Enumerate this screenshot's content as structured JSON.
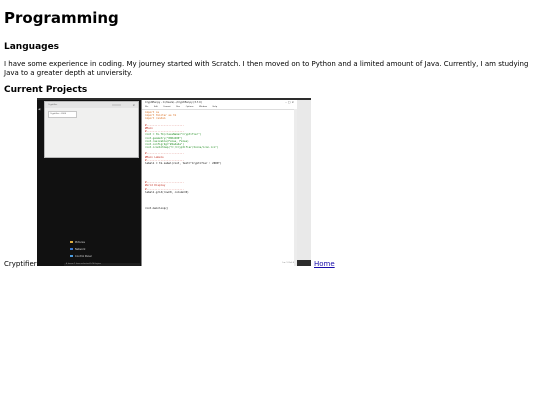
{
  "page": {
    "title": "Programming",
    "languages_heading": "Languages",
    "languages_text": "I have some experience in coding. My journey started with Scratch. I then moved on to Python and a limited amount of Java. Currently, I am studying Java to a greater depth at unviersity.",
    "projects_heading": "Current Projects",
    "project_label": "Cryptifier",
    "home_link": "Home"
  },
  "screenshot": {
    "dialog_title": "Cryptifier",
    "dialog_field": "Cryptifier.: 2000",
    "ide_title": "Cryptifier.py - C:/Users/.../Cryptifier.py (3.7.0)",
    "ide_menu": [
      "File",
      "Edit",
      "Format",
      "Run",
      "Options",
      "Window",
      "Help"
    ],
    "explorer_items": [
      "Pictures",
      "Network",
      "Control Panel"
    ],
    "status_text": "4 items   1 item selected  5.96 bytes",
    "code_lines": [
      {
        "t": "import os",
        "c": "kw"
      },
      {
        "t": "import tkinter as tk",
        "c": "kw"
      },
      {
        "t": "import random",
        "c": "kw"
      },
      {
        "t": "",
        "c": "df"
      },
      {
        "t": "#------------------------",
        "c": "cm"
      },
      {
        "t": "#Main",
        "c": "cm"
      },
      {
        "t": "#------------------------",
        "c": "cm"
      },
      {
        "t": "root = tk.Tk(className=\"Cryptifier\")",
        "c": "st"
      },
      {
        "t": "root.geometry(\"800x600\")",
        "c": "st"
      },
      {
        "t": "root.resizable(False, False)",
        "c": "st"
      },
      {
        "t": "root.config(bg=\"#4a4a4a\")",
        "c": "st"
      },
      {
        "t": "root.iconbitmap(\"C:/Cryptifier/Icons/icon.ico\")",
        "c": "st"
      },
      {
        "t": "",
        "c": "df"
      },
      {
        "t": "#------------------------",
        "c": "cm"
      },
      {
        "t": "#Main Labels",
        "c": "cm"
      },
      {
        "t": "#------------------------",
        "c": "cm"
      },
      {
        "t": "label1 = tk.Label(root, text=\"Cryptifier : 2000\")",
        "c": "df"
      },
      {
        "t": "",
        "c": "df"
      },
      {
        "t": "",
        "c": "df"
      },
      {
        "t": "",
        "c": "df"
      },
      {
        "t": "",
        "c": "df"
      },
      {
        "t": "",
        "c": "df"
      },
      {
        "t": "#------------------------",
        "c": "cm"
      },
      {
        "t": "#Grid Display",
        "c": "cm"
      },
      {
        "t": "#------------------------",
        "c": "cm"
      },
      {
        "t": "label1.grid(row=0, column=0)",
        "c": "df"
      },
      {
        "t": "",
        "c": "df"
      },
      {
        "t": "",
        "c": "df"
      },
      {
        "t": "",
        "c": "df"
      },
      {
        "t": "",
        "c": "df"
      },
      {
        "t": "root.mainloop()",
        "c": "df"
      }
    ],
    "ide_status": "Ln: 1  Col: 0"
  }
}
